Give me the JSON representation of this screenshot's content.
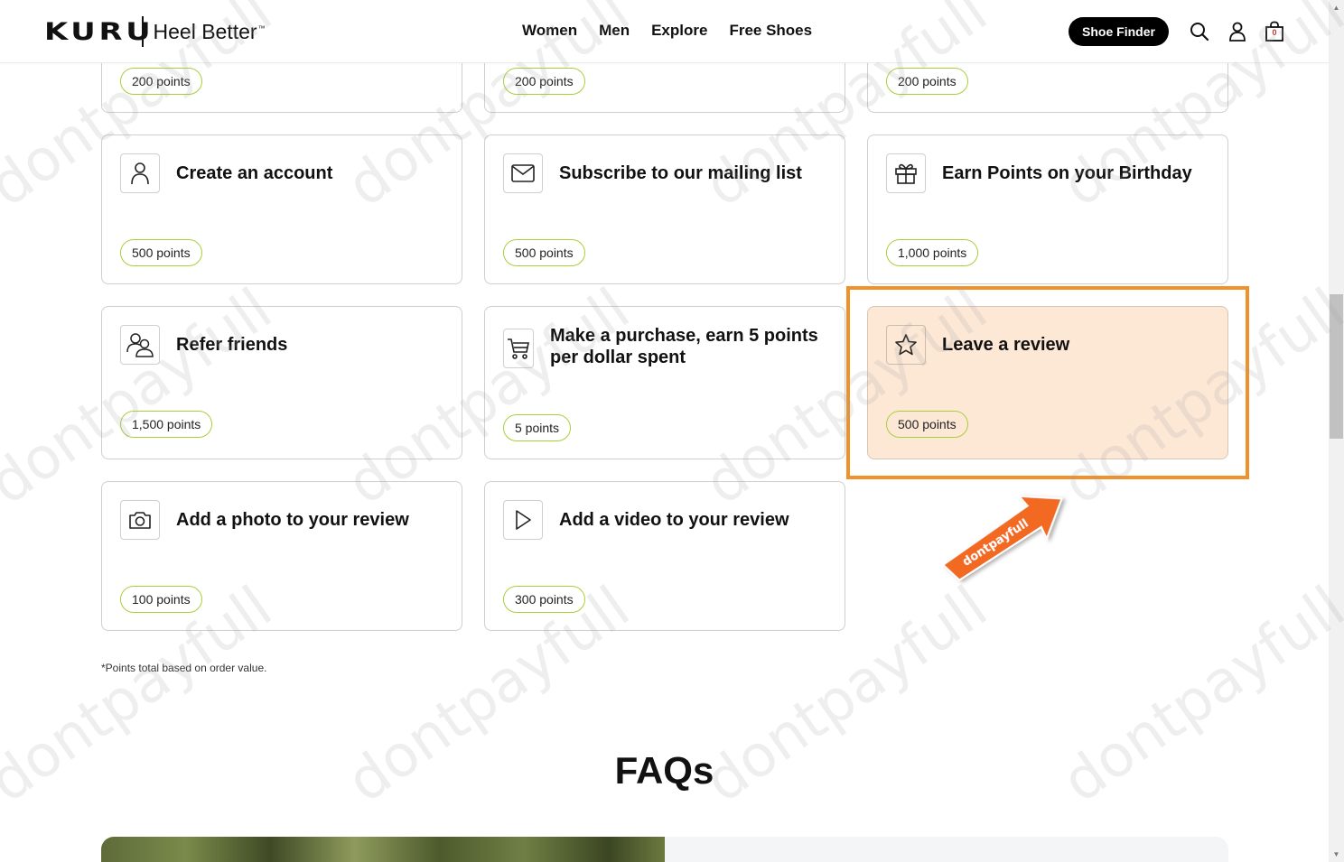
{
  "header": {
    "logo_text": "KURU",
    "tagline": "Heel Better",
    "tagline_mark": "™",
    "nav": [
      "Women",
      "Men",
      "Explore",
      "Free Shoes"
    ],
    "shoe_finder": "Shoe Finder",
    "cart_count": "0"
  },
  "top_row_points": [
    "200 points",
    "200 points",
    "200 points"
  ],
  "cards": [
    {
      "title": "Create an account",
      "points": "500 points",
      "icon": "user-icon"
    },
    {
      "title": "Subscribe to our mailing list",
      "points": "500 points",
      "icon": "mail-icon"
    },
    {
      "title": "Earn Points on your Birthday",
      "points": "1,000 points",
      "icon": "gift-icon"
    },
    {
      "title": "Refer friends",
      "points": "1,500 points",
      "icon": "users-icon"
    },
    {
      "title": "Make a purchase, earn 5 points per dollar spent",
      "points": "5 points",
      "icon": "cart-icon"
    },
    {
      "title": "Leave a review",
      "points": "500 points",
      "icon": "star-icon"
    },
    {
      "title": "Add a photo to your review",
      "points": "100 points",
      "icon": "camera-icon"
    },
    {
      "title": "Add a video to your review",
      "points": "300 points",
      "icon": "play-icon"
    }
  ],
  "arrow_label": "dontpayfull",
  "footnote": "*Points total based on order value.",
  "faqs_title": "FAQs",
  "watermark": "dontpayfull",
  "colors": {
    "highlight": "#f0922b",
    "highlight_bg": "#fde8d6",
    "pill_border": "#a8cf3a",
    "arrow": "#f26a21"
  }
}
